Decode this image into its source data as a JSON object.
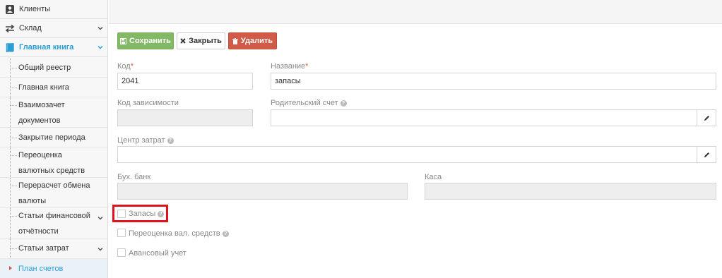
{
  "sidebar": {
    "items": [
      {
        "label": "Клиенты",
        "icon": "user-icon"
      },
      {
        "label": "Склад",
        "icon": "transfer-icon"
      },
      {
        "label": "Главная книга",
        "icon": "book-icon"
      }
    ],
    "subitems": [
      {
        "label": "Общий реестр"
      },
      {
        "label": "Главная книга"
      },
      {
        "label": "Взаимозачет документов"
      },
      {
        "label": "Закрытие периода"
      },
      {
        "label": "Переоценка валютных средств"
      },
      {
        "label": "Перерасчет обмена валюты"
      },
      {
        "label": "Статьи финансовой отчётности"
      },
      {
        "label": "Статьи затрат"
      },
      {
        "label": "План счетов"
      }
    ]
  },
  "toolbar": {
    "save_label": "Сохранить",
    "close_label": "Закрыть",
    "delete_label": "Удалить"
  },
  "form": {
    "code_label": "Код",
    "code_value": "2041",
    "name_label": "Название",
    "name_value": "запасы",
    "dependency_code_label": "Код зависимости",
    "parent_account_label": "Родительский счет",
    "cost_center_label": "Центр затрат",
    "bank_label": "Бух. банк",
    "cash_label": "Каса",
    "required_mark": "*",
    "help_mark": "?",
    "checkboxes": [
      {
        "label": "Запасы",
        "checked": false
      },
      {
        "label": "Переоценка вал. средств",
        "checked": false
      },
      {
        "label": "Авансовый учет",
        "checked": false
      }
    ]
  },
  "colors": {
    "accent": "#2a9fd6",
    "save": "#82b964",
    "delete": "#d15b47",
    "highlight": "#e0141c"
  }
}
